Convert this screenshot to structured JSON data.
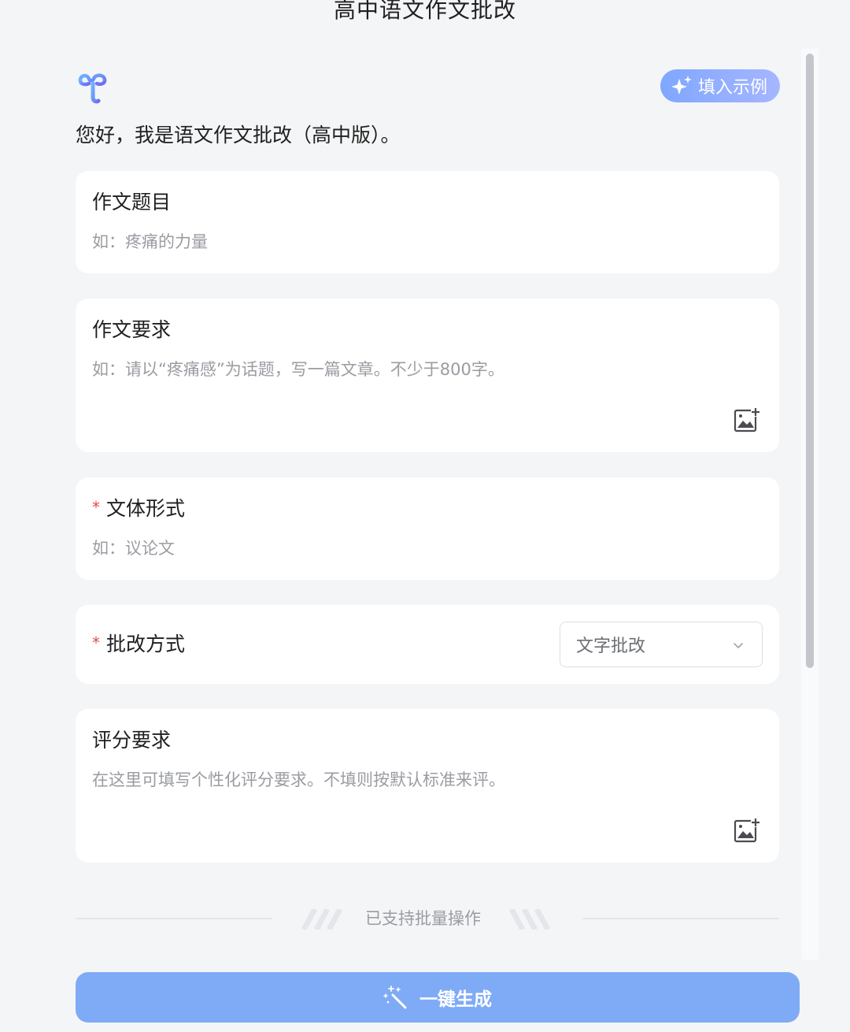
{
  "header": {
    "title": "高中语文作文批改"
  },
  "intro": {
    "fill_example_label": "填入示例",
    "greeting": "您好，我是语文作文批改（高中版）。"
  },
  "fields": {
    "topic": {
      "label": "作文题目",
      "placeholder": "如：疼痛的力量"
    },
    "requirements": {
      "label": "作文要求",
      "placeholder": "如：请以“疼痛感”为话题，写一篇文章。不少于800字。"
    },
    "genre": {
      "required_mark": "*",
      "label": "文体形式",
      "placeholder": "如：议论文"
    },
    "method": {
      "required_mark": "*",
      "label": "批改方式",
      "selected": "文字批改"
    },
    "scoring": {
      "label": "评分要求",
      "placeholder": "在这里可填写个性化评分要求。不填则按默认标准来评。"
    }
  },
  "batch": {
    "text": "已支持批量操作"
  },
  "footer": {
    "generate_label": "一键生成"
  },
  "icons": {
    "logo": "logo-icon",
    "sparkle": "sparkle-icon",
    "image_upload": "image-upload-icon",
    "chevron": "chevron-down-icon",
    "wand": "magic-wand-icon"
  },
  "colors": {
    "required": "#e5484d",
    "accent_button": "#7fabf6",
    "fill_example_gradient_start": "#7fa7ff",
    "fill_example_gradient_end": "#a6b6ff",
    "placeholder": "#9a9ca2",
    "background": "#f4f5f7"
  }
}
